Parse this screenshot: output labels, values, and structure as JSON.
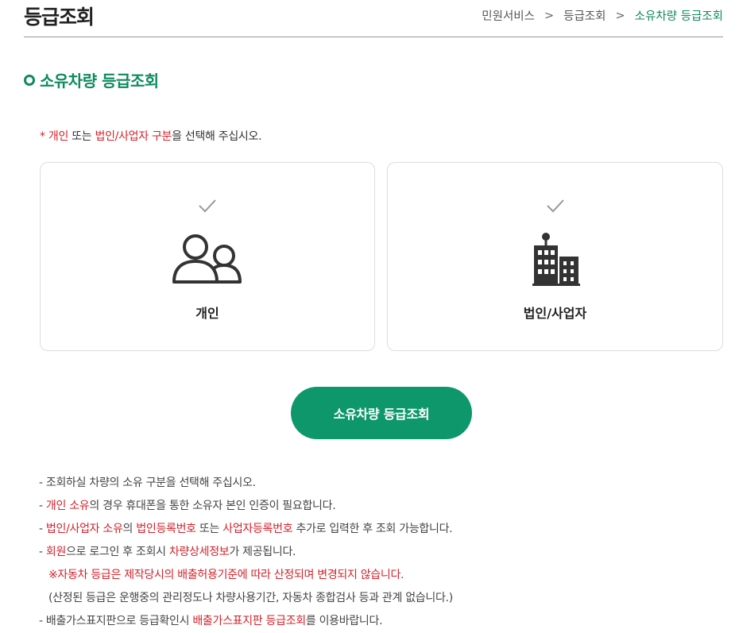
{
  "header": {
    "title": "등급조회",
    "breadcrumb": [
      "민원서비스",
      "등급조회",
      "소유차량 등급조회"
    ],
    "separator": ">"
  },
  "section": {
    "title": "소유차량 등급조회"
  },
  "instruction": {
    "prefix": "* ",
    "highlight1": "개인",
    "middle": " 또는 ",
    "highlight2": "법인/사업자 구분",
    "suffix": "을 선택해 주십시오."
  },
  "cards": {
    "personal": {
      "label": "개인",
      "icon": "people-icon"
    },
    "corporate": {
      "label": "법인/사업자",
      "icon": "building-icon"
    }
  },
  "search_button": {
    "label": "소유차량 등급조회"
  },
  "notes": {
    "n1": "- 조회하실 차량의 소유 구분을 선택해 주십시오.",
    "n2_prefix": "- ",
    "n2_red": "개인 소유",
    "n2_suffix": "의 경우 휴대폰을 통한 소유자 본인 인증이 필요합니다.",
    "n3_prefix": "- ",
    "n3_red1": "법인/사업자 소유",
    "n3_mid1": "의 ",
    "n3_red2": "법인등록번호",
    "n3_mid2": " 또는 ",
    "n3_red3": "사업자등록번호",
    "n3_suffix": " 추가로 입력한 후 조회 가능합니다.",
    "n4_prefix": "- ",
    "n4_red1": "회원",
    "n4_mid": "으로 로그인 후 조회시 ",
    "n4_red2": "차량상세정보",
    "n4_suffix": "가 제공됩니다.",
    "n5": "※자동차 등급은 제작당시의 배출허용기준에 따라 산정되며 변경되지 않습니다.",
    "n6": "(산정된 등급은 운행중의 관리정도나 차량사용기간, 자동차 종합검사 등과 관계 없습니다.)",
    "n7_prefix": "- 배출가스표지판으로 등급확인시 ",
    "n7_red": "배출가스표지판 등급조회",
    "n7_suffix": "를 이용바랍니다."
  },
  "colors": {
    "accent": "#0e8a5f",
    "button": "#0e976a",
    "highlight": "#d3222a"
  }
}
